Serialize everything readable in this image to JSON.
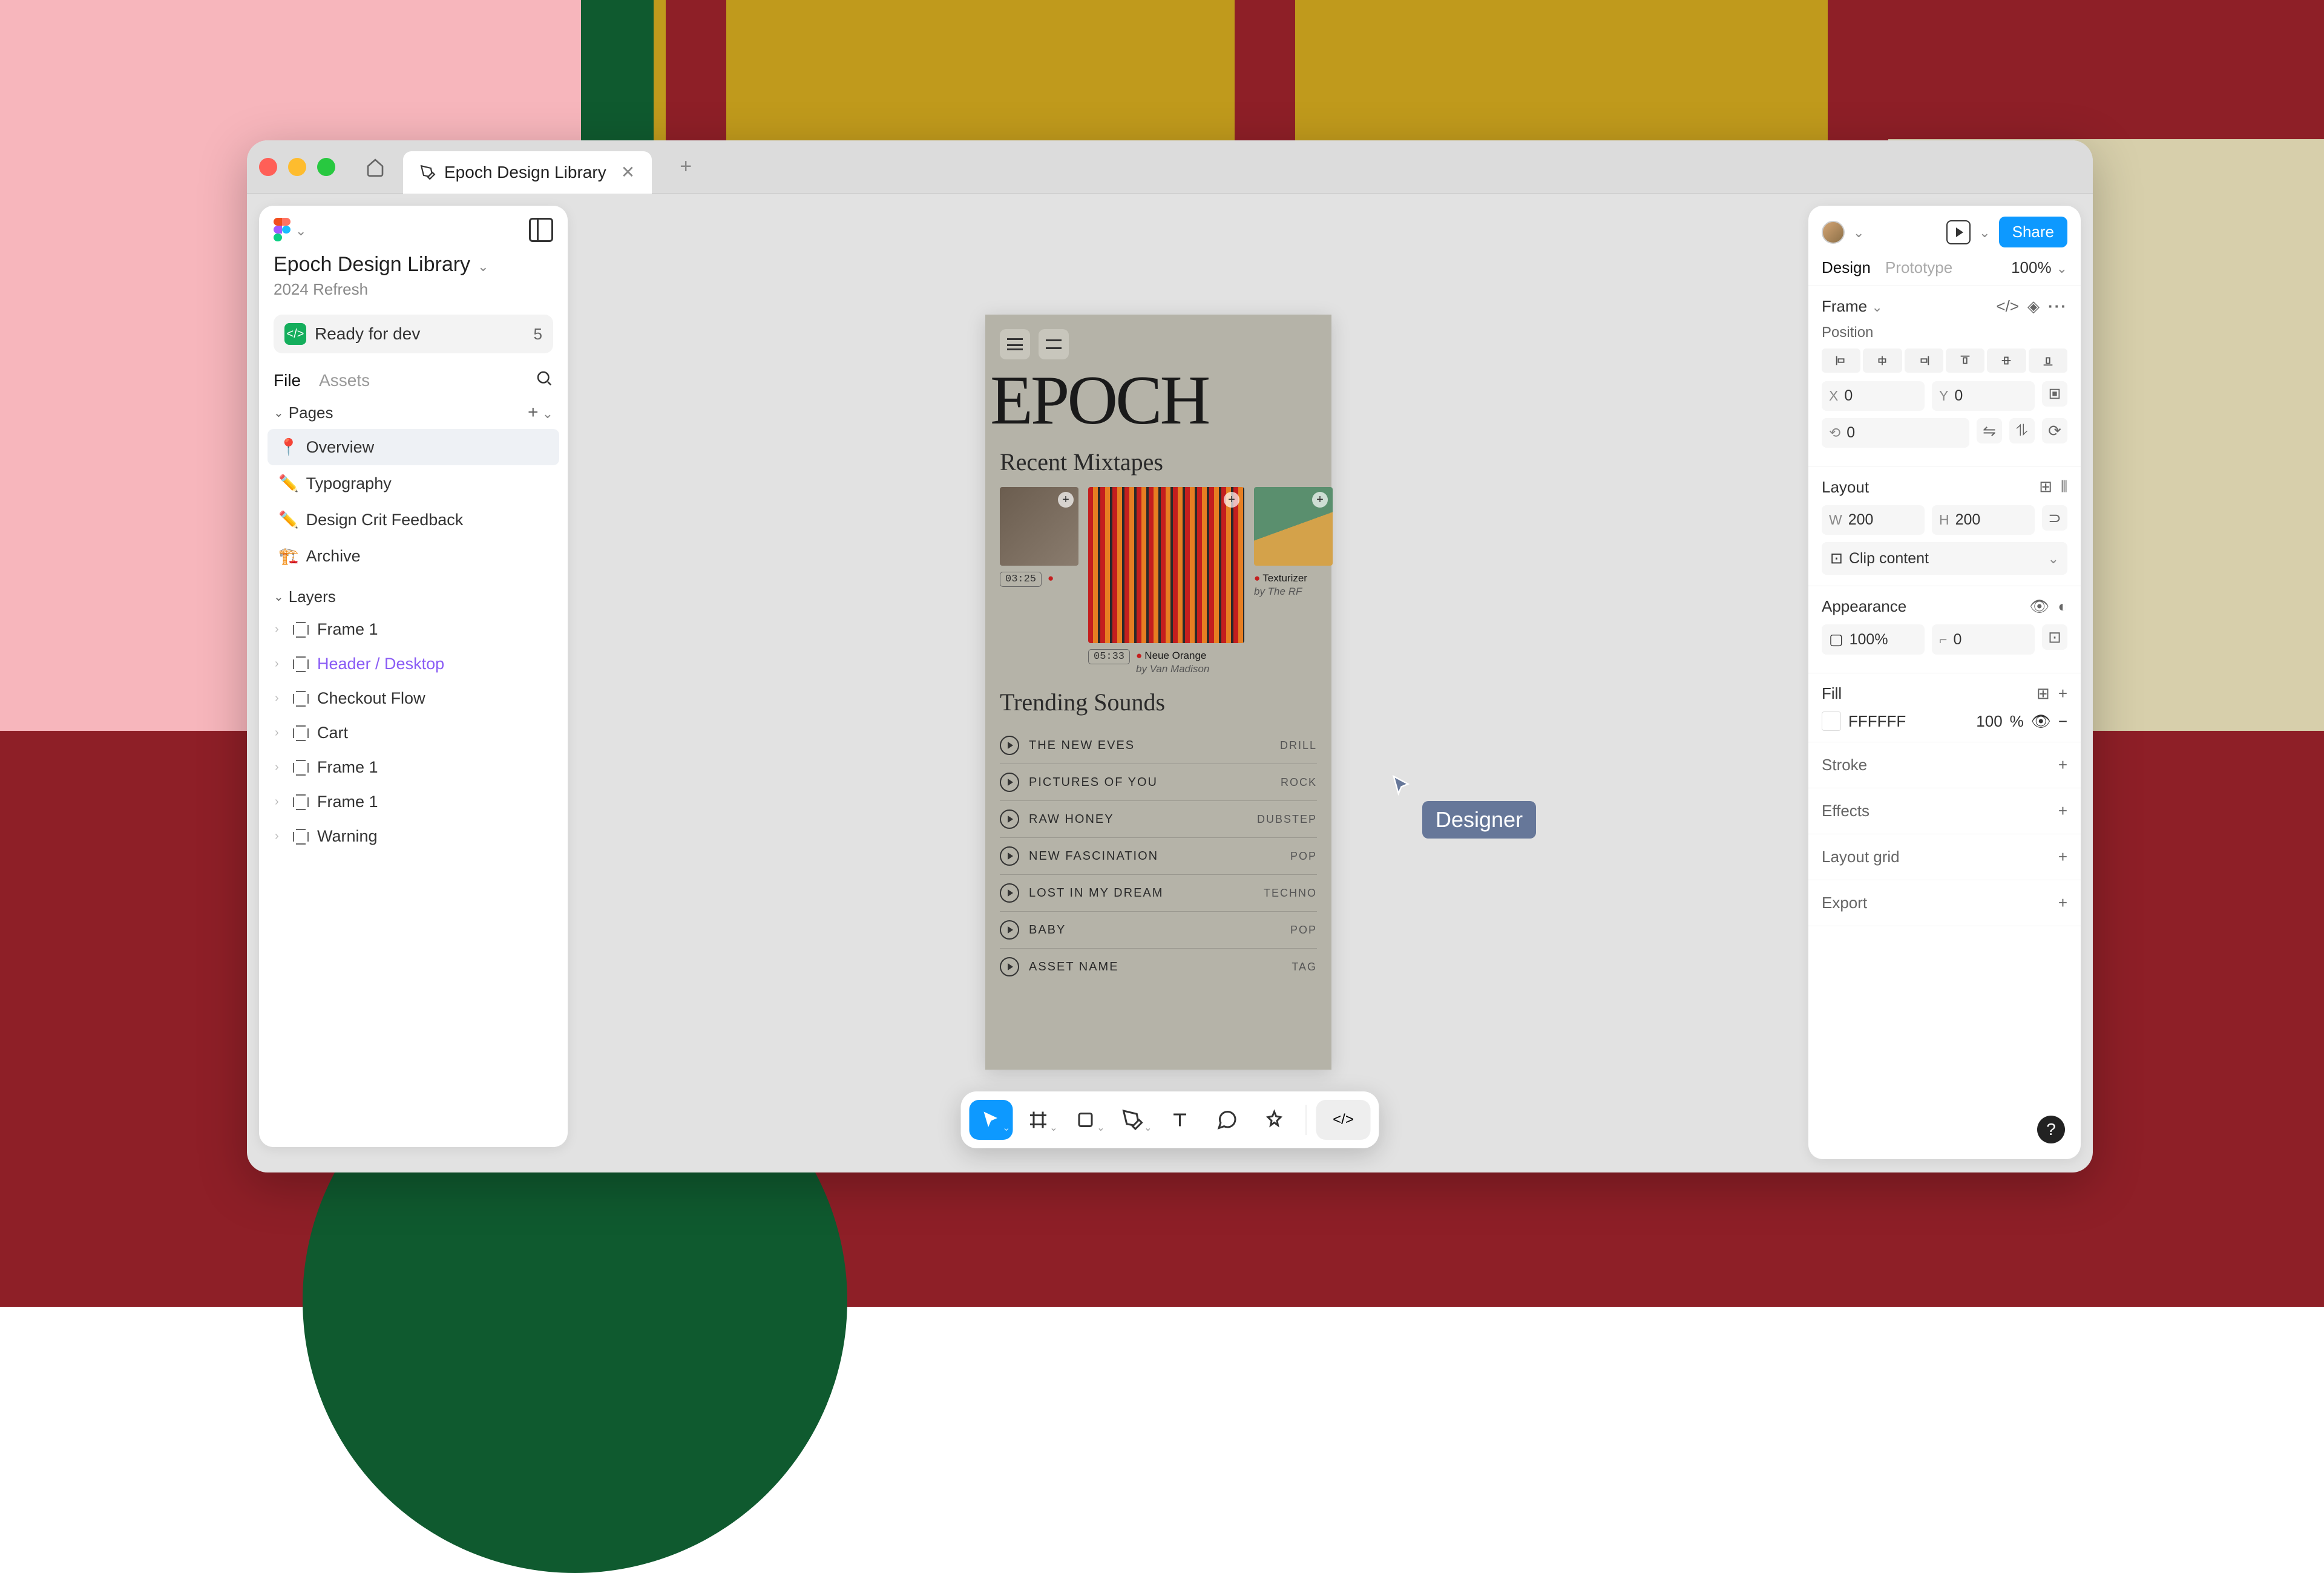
{
  "titlebar": {
    "tab_title": "Epoch Design Library"
  },
  "left_panel": {
    "file_title": "Epoch Design Library",
    "file_subtitle": "2024 Refresh",
    "ready_label": "Ready for dev",
    "ready_count": "5",
    "tabs": {
      "file": "File",
      "assets": "Assets"
    },
    "pages_header": "Pages",
    "pages": [
      {
        "icon": "📍",
        "label": "Overview",
        "selected": true
      },
      {
        "icon": "✏️",
        "label": "Typography",
        "selected": false
      },
      {
        "icon": "✏️",
        "label": "Design Crit Feedback",
        "selected": false
      },
      {
        "icon": "🏗️",
        "label": "Archive",
        "selected": false
      }
    ],
    "layers_header": "Layers",
    "layers": [
      {
        "label": "Frame 1",
        "highlight": false
      },
      {
        "label": "Header / Desktop",
        "highlight": true
      },
      {
        "label": "Checkout Flow",
        "highlight": false
      },
      {
        "label": "Cart",
        "highlight": false
      },
      {
        "label": "Frame 1",
        "highlight": false
      },
      {
        "label": "Frame 1",
        "highlight": false
      },
      {
        "label": "Warning",
        "highlight": false
      }
    ]
  },
  "canvas": {
    "logo": "EPOCH",
    "recent_title": "Recent Mixtapes",
    "mixtapes": [
      {
        "time": "03:25",
        "name": "",
        "by": ""
      },
      {
        "time": "05:33",
        "name": "Neue Orange",
        "by": "by Van Madison"
      },
      {
        "time": "",
        "name": "Texturizer",
        "by": "by The RF"
      }
    ],
    "trending_title": "Trending Sounds",
    "sounds": [
      {
        "title": "THE NEW EVES",
        "tag": "DRILL"
      },
      {
        "title": "PICTURES OF YOU",
        "tag": "ROCK"
      },
      {
        "title": "RAW HONEY",
        "tag": "DUBSTEP"
      },
      {
        "title": "NEW FASCINATION",
        "tag": "POP"
      },
      {
        "title": "LOST IN MY DREAM",
        "tag": "TECHNO"
      },
      {
        "title": "BABY",
        "tag": "POP"
      },
      {
        "title": "ASSET NAME",
        "tag": "TAG"
      }
    ]
  },
  "collaborator": {
    "label": "Designer"
  },
  "right_panel": {
    "share": "Share",
    "tabs": {
      "design": "Design",
      "prototype": "Prototype"
    },
    "zoom": "100%",
    "frame_label": "Frame",
    "sections": {
      "position": "Position",
      "layout": "Layout",
      "appearance": "Appearance",
      "fill": "Fill",
      "stroke": "Stroke",
      "effects": "Effects",
      "layout_grid": "Layout grid",
      "export": "Export"
    },
    "position": {
      "x_label": "X",
      "x": "0",
      "y_label": "Y",
      "y": "0",
      "rot_label": "⟲",
      "rot": "0"
    },
    "layout": {
      "w_label": "W",
      "w": "200",
      "h_label": "H",
      "h": "200",
      "clip": "Clip content"
    },
    "appearance": {
      "opacity": "100%",
      "corner_label": "⌐",
      "corner": "0"
    },
    "fill": {
      "hex": "FFFFFF",
      "pct": "100",
      "pct_unit": "%"
    }
  },
  "toolbar": {
    "tools": [
      "move",
      "frame",
      "shape",
      "pen",
      "text",
      "comment",
      "actions",
      "devmode"
    ]
  }
}
